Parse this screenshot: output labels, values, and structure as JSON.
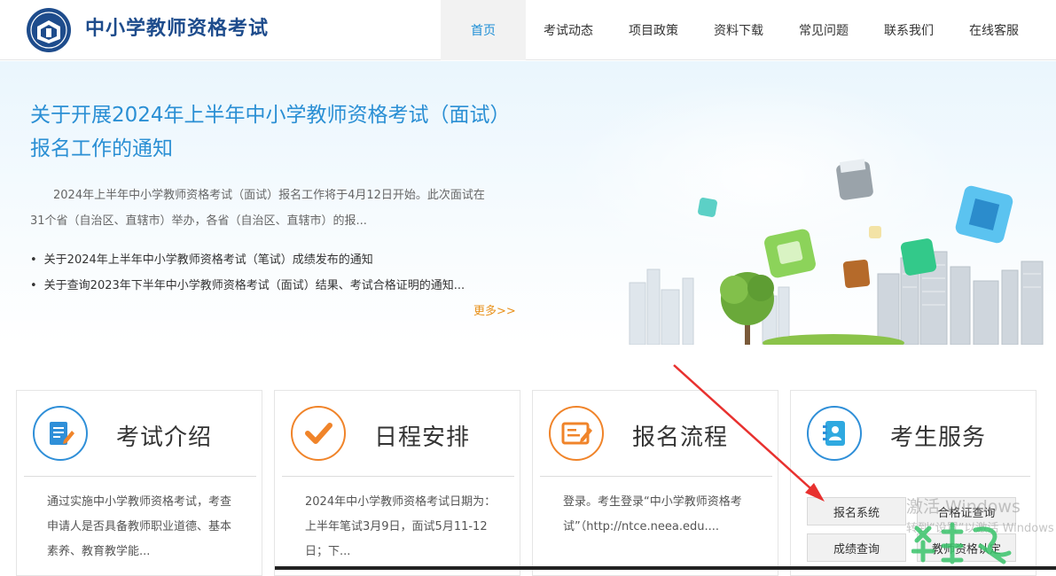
{
  "header": {
    "site_title": "中小学教师资格考试",
    "nav": [
      {
        "label": "首页",
        "active": true
      },
      {
        "label": "考试动态"
      },
      {
        "label": "项目政策"
      },
      {
        "label": "资料下载"
      },
      {
        "label": "常见问题"
      },
      {
        "label": "联系我们"
      },
      {
        "label": "在线客服"
      }
    ]
  },
  "banner": {
    "title": "关于开展2024年上半年中小学教师资格考试（面试）报名工作的通知",
    "summary": "2024年上半年中小学教师资格考试（面试）报名工作将于4月12日开始。此次面试在31个省（自治区、直辖市）举办，各省（自治区、直辖市）的报...",
    "links": [
      "关于2024年上半年中小学教师资格考试（笔试）成绩发布的通知",
      "关于查询2023年下半年中小学教师资格考试（面试）结果、考试合格证明的通知..."
    ],
    "more": "更多>>"
  },
  "cards": [
    {
      "title": "考试介绍",
      "icon": "document-edit-icon",
      "text": "通过实施中小学教师资格考试，考查申请人是否具备教师职业道德、基本素养、教育教学能..."
    },
    {
      "title": "日程安排",
      "icon": "checkmark-icon",
      "text": "2024年中小学教师资格考试日期为：上半年笔试3月9日，面试5月11-12日；下..."
    },
    {
      "title": "报名流程",
      "icon": "form-pen-icon",
      "text": "登录。考生登录“中小学教师资格考试”（http://ntce.neea.edu...."
    },
    {
      "title": "考生服务",
      "icon": "contacts-book-icon",
      "buttons": [
        "报名系统",
        "合格证查询",
        "成绩查询",
        "教师资格认定"
      ]
    }
  ],
  "overlay": {
    "watermark_line1": "激活 Windows",
    "watermark_line2": "转到“设置”以激活 Windows"
  },
  "colors": {
    "accent": "#2a8fd4",
    "orange": "#f0842a",
    "title_blue": "#1e4c8c",
    "more": "#e8911b"
  }
}
